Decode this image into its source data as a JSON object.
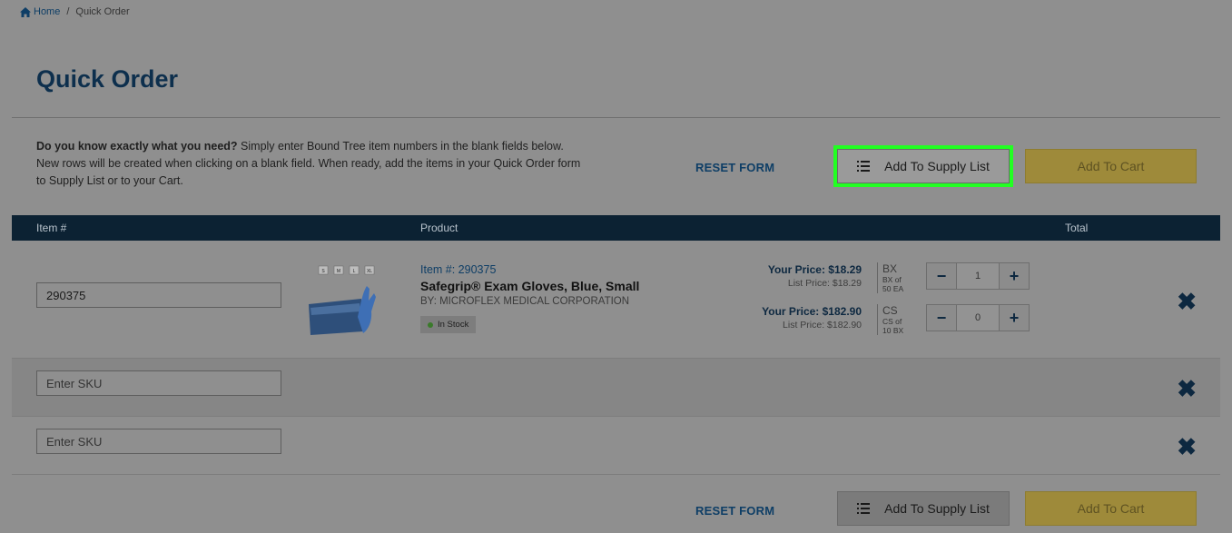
{
  "breadcrumb": {
    "home": "Home",
    "separator": "/",
    "current": "Quick Order"
  },
  "page_title": "Quick Order",
  "intro": {
    "bold": "Do you know exactly what you need?",
    "text": " Simply enter Bound Tree item numbers in the blank fields below. New rows will be created when clicking on a blank field. When ready, add the items in your Quick Order form to Supply List or to your Cart."
  },
  "actions": {
    "reset": "RESET FORM",
    "add_supply": "Add To Supply List",
    "add_cart": "Add To Cart"
  },
  "table": {
    "headers": {
      "item": "Item #",
      "product": "Product",
      "total": "Total"
    },
    "sku_placeholder": "Enter SKU",
    "item": {
      "sku_value": "290375",
      "item_number": "Item #: 290375",
      "name": "Safegrip® Exam Gloves, Blue, Small",
      "brand": "BY: MICROFLEX MEDICAL CORPORATION",
      "stock": "In Stock",
      "thumb_sizes": [
        "S",
        "M",
        "L",
        "XL"
      ],
      "prices": [
        {
          "your_price": "Your Price: $18.29",
          "list_price": "List Price: $18.29",
          "unit": "BX",
          "unit_desc": [
            "BX of",
            "50 EA"
          ],
          "qty": "1"
        },
        {
          "your_price": "Your Price: $182.90",
          "list_price": "List Price: $182.90",
          "unit": "CS",
          "unit_desc": [
            "CS of",
            "10 BX"
          ],
          "qty": "0"
        }
      ]
    }
  },
  "colors": {
    "highlight": "#22ff22",
    "navy": "#0c2233",
    "cart": "#9e8a3a"
  },
  "icons": {
    "home": "home-icon",
    "list": "list-icon",
    "remove": "close-icon",
    "minus": "minus-icon",
    "plus": "plus-icon"
  }
}
